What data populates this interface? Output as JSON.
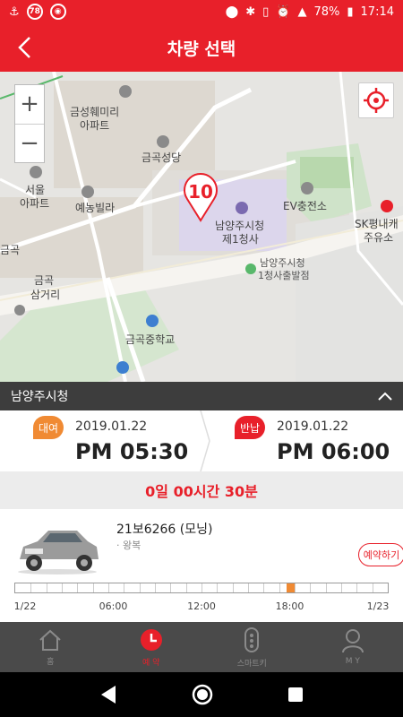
{
  "status_bar": {
    "badge_78": "78",
    "battery": "78%",
    "time": "17:14"
  },
  "app_bar": {
    "title": "차량 선택"
  },
  "map": {
    "labels": {
      "apartment1": "금성훼미리\n아파트",
      "church": "금곡성당",
      "seoul_apt_1": "서울",
      "seoul_apt_2": "아파트",
      "villa": "예농빌라",
      "city_hall_1": "남양주시청",
      "city_hall_2": "제1청사",
      "ev": "EV충전소",
      "sk_1": "SK평내캐",
      "sk_2": "주유소",
      "branch_1": "남양주시청",
      "branch_2": "1청사출발점",
      "geumgok": "금곡",
      "geumgok2": "금곡",
      "intersection": "삼거리",
      "middle_school": "금곡중학교"
    },
    "pin_number": "10",
    "zoom_in": "+",
    "zoom_out": "−"
  },
  "station": {
    "name": "남양주시청"
  },
  "rental": {
    "rent_tag": "대여",
    "rent_date": "2019.01.22",
    "rent_time": "PM 05:30",
    "return_tag": "반납",
    "return_date": "2019.01.22",
    "return_time": "PM 06:00"
  },
  "duration": "0일 00시간 30분",
  "car": {
    "name": "21보6266 (모닝)",
    "type": "· 왕복",
    "reserve_label": "예약하기",
    "timeline_labels": [
      "1/22",
      "06:00",
      "12:00",
      "18:00",
      "1/23"
    ],
    "reserved_fraction_start": 0.729,
    "reserved_fraction_end": 0.75
  },
  "bottom_nav": [
    {
      "label": "홈",
      "icon": "home-icon",
      "active": false
    },
    {
      "label": "예 약",
      "icon": "clock-icon",
      "active": true
    },
    {
      "label": "스마트키",
      "icon": "smartkey-icon",
      "active": false
    },
    {
      "label": "M Y",
      "icon": "person-icon",
      "active": false
    }
  ],
  "colors": {
    "primary": "#e8202a",
    "accent": "#f08a33"
  }
}
